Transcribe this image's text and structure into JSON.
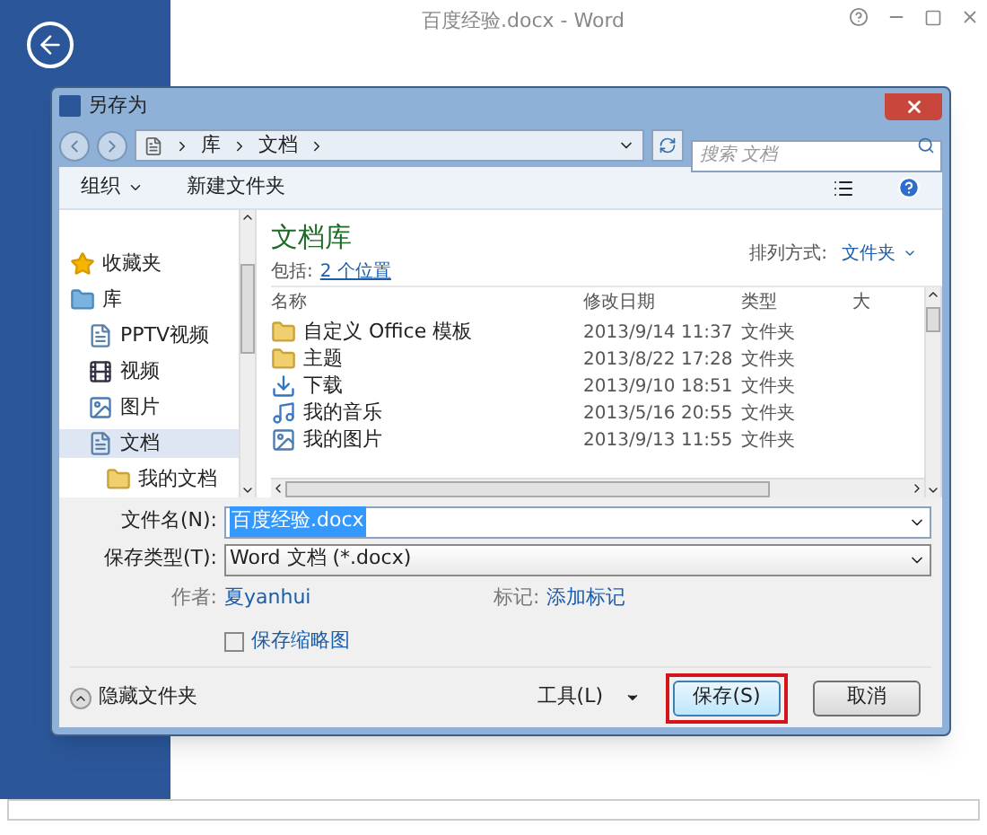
{
  "word_window": {
    "title": "百度经验.docx - Word"
  },
  "dialog": {
    "title": "另存为",
    "breadcrumb": [
      "库",
      "文档"
    ],
    "search": {
      "placeholder": "搜索 文档"
    },
    "toolbar": {
      "organize": "组织",
      "new_folder": "新建文件夹"
    },
    "nav": [
      {
        "label": "收藏夹",
        "kind": "star",
        "selected": false
      },
      {
        "label": "库",
        "kind": "library",
        "selected": false,
        "children": [
          {
            "label": "PPTV视频",
            "kind": "doc",
            "selected": false
          },
          {
            "label": "视频",
            "kind": "video",
            "selected": false
          },
          {
            "label": "图片",
            "kind": "picture",
            "selected": false
          },
          {
            "label": "文档",
            "kind": "doc",
            "selected": true,
            "children": [
              {
                "label": "我的文档",
                "kind": "folder",
                "selected": false
              }
            ]
          }
        ]
      }
    ],
    "library": {
      "title": "文档库",
      "includes_label": "包括:",
      "includes_link": "2 个位置",
      "sort_label": "排列方式:",
      "sort_value": "文件夹"
    },
    "columns": [
      "名称",
      "修改日期",
      "类型",
      "大"
    ],
    "rows": [
      {
        "name": "自定义 Office 模板",
        "date": "2013/9/14 11:37",
        "type": "文件夹",
        "kind": "folder"
      },
      {
        "name": "主题",
        "date": "2013/8/22 17:28",
        "type": "文件夹",
        "kind": "folder"
      },
      {
        "name": "下载",
        "date": "2013/9/10 18:51",
        "type": "文件夹",
        "kind": "download"
      },
      {
        "name": "我的音乐",
        "date": "2013/5/16 20:55",
        "type": "文件夹",
        "kind": "music"
      },
      {
        "name": "我的图片",
        "date": "2013/9/13 11:55",
        "type": "文件夹",
        "kind": "picture"
      }
    ],
    "filename": {
      "label": "文件名(N):",
      "value": "百度经验.docx"
    },
    "filetype": {
      "label": "保存类型(T):",
      "value": "Word 文档 (*.docx)"
    },
    "author": {
      "label": "作者:",
      "value": "夏yanhui"
    },
    "tags": {
      "label": "标记:",
      "value": "添加标记"
    },
    "thumbnail": {
      "label": "保存缩略图",
      "checked": false
    },
    "hide_folders": "隐藏文件夹",
    "tools": "工具(L)",
    "save": {
      "label": "保存(S)",
      "highlighted": true
    },
    "cancel": "取消"
  }
}
